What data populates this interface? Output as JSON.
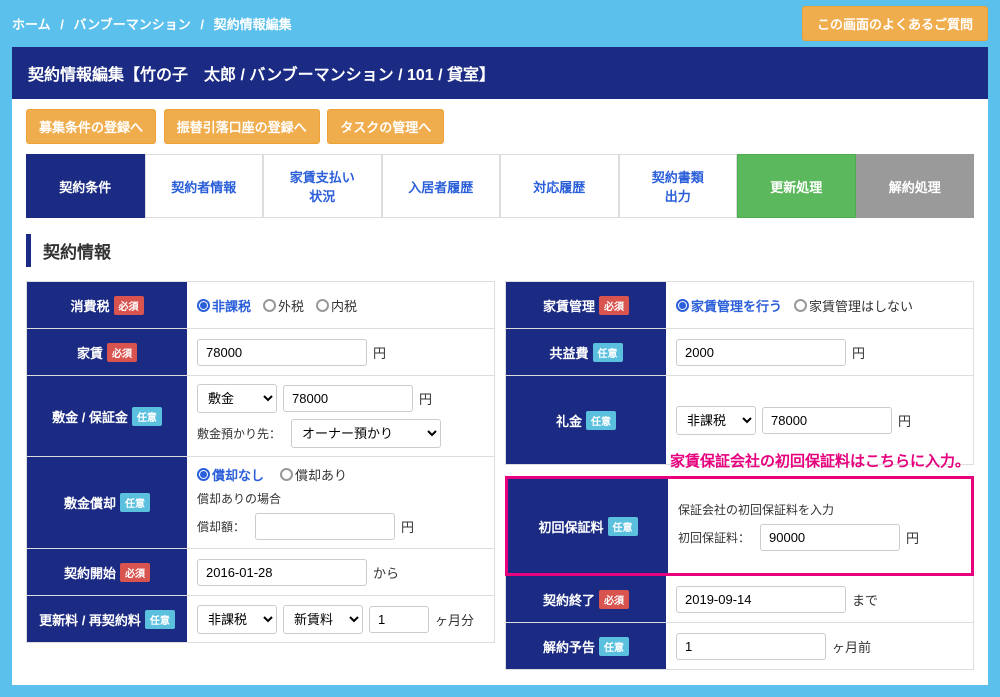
{
  "breadcrumb": {
    "home": "ホーム",
    "b1": "バンブーマンション",
    "b2": "契約情報編集"
  },
  "faq_btn": "この画面のよくあるご質問",
  "title": "契約情報編集【竹の子　太郎 / バンブーマンション / 101 / 貸室】",
  "actions": {
    "a1": "募集条件の登録へ",
    "a2": "振替引落口座の登録へ",
    "a3": "タスクの管理へ"
  },
  "tabs": {
    "t1": "契約条件",
    "t2": "契約者情報",
    "t3": "家賃支払い\n状況",
    "t4": "入居者履歴",
    "t5": "対応履歴",
    "t6": "契約書類\n出力",
    "t7": "更新処理",
    "t8": "解約処理"
  },
  "section_title": "契約情報",
  "badges": {
    "req": "必須",
    "opt": "任意"
  },
  "labels": {
    "tax": "消費税",
    "rent": "家賃",
    "deposit": "敷金 / 保証金",
    "deposit_ded": "敷金償却",
    "start": "契約開始",
    "renew": "更新料 / 再契約料",
    "mgmt": "家賃管理",
    "common": "共益費",
    "key": "礼金",
    "init_guar": "初回保証料",
    "end": "契約終了",
    "cancel_notice": "解約予告"
  },
  "tax": {
    "r1": "非課税",
    "r2": "外税",
    "r3": "内税"
  },
  "mgmt": {
    "r1": "家賃管理を行う",
    "r2": "家賃管理はしない"
  },
  "rent": {
    "value": "78000",
    "suffix": "円"
  },
  "common": {
    "value": "2000",
    "suffix": "円"
  },
  "deposit": {
    "sel": "敷金",
    "value": "78000",
    "suffix": "円",
    "custody_label": "敷金預かり先：",
    "custody_sel": "オーナー預かり"
  },
  "key": {
    "sel": "非課税",
    "value": "78000",
    "suffix": "円"
  },
  "ded": {
    "r1": "償却なし",
    "r2": "償却あり",
    "help": "償却ありの場合",
    "amt_label": "償却額：",
    "amt": "",
    "suffix": "円"
  },
  "init_guar": {
    "help": "保証会社の初回保証料を入力",
    "sub": "初回保証料：",
    "value": "90000",
    "suffix": "円"
  },
  "start": {
    "value": "2016-01-28",
    "suffix": "から"
  },
  "end": {
    "value": "2019-09-14",
    "suffix": "まで"
  },
  "renew": {
    "sel1": "非課税",
    "sel2": "新賃料",
    "value": "1",
    "suffix": "ヶ月分"
  },
  "cancel": {
    "value": "1",
    "suffix": "ヶ月前"
  },
  "annotation": "家賃保証会社の初回保証料はこちらに入力。"
}
